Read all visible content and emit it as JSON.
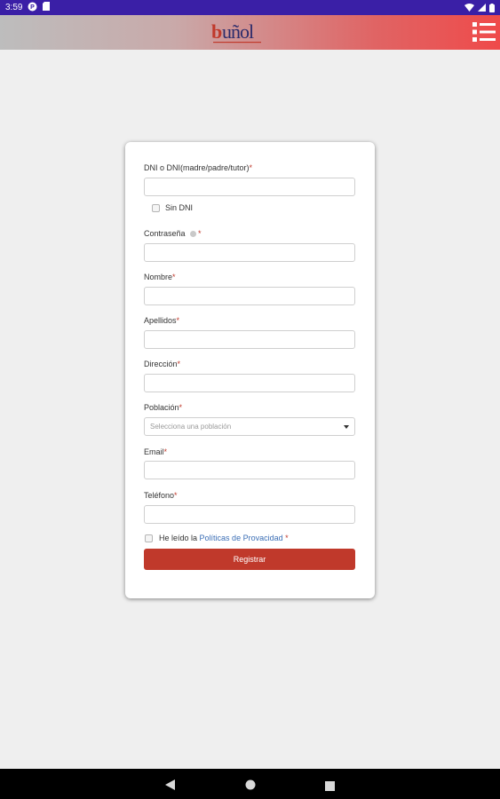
{
  "status_bar": {
    "time": "3:59",
    "icons": [
      "notification-app-icon",
      "sd-card-icon",
      "wifi-icon",
      "signal-icon",
      "battery-icon"
    ]
  },
  "header": {
    "logo_text": "buñol",
    "menu_icon": "menu-list-icon",
    "colors": {
      "start": "#bdbdbd",
      "end": "#ef4a4a"
    }
  },
  "form": {
    "dni": {
      "label": "DNI o DNI(madre/padre/tutor)",
      "required_mark": "*",
      "value": "",
      "placeholder": ""
    },
    "no_dni": {
      "label": "Sin DNI",
      "checked": false
    },
    "password": {
      "label": "Contraseña",
      "required_mark": "*",
      "value": "",
      "help_icon": "info-icon"
    },
    "name": {
      "label": "Nombre",
      "required_mark": "*",
      "value": ""
    },
    "surname": {
      "label": "Apellidos",
      "required_mark": "*",
      "value": ""
    },
    "address": {
      "label": "Dirección",
      "required_mark": "*",
      "value": ""
    },
    "town": {
      "label": "Población",
      "required_mark": "*",
      "selected": "Selecciona una población"
    },
    "email": {
      "label": "Email",
      "required_mark": "*",
      "value": ""
    },
    "phone": {
      "label": "Teléfono",
      "required_mark": "*",
      "value": ""
    },
    "privacy": {
      "prefix": "He leído la",
      "link": "Políticas de Provacidad",
      "required_mark": "*",
      "checked": false
    },
    "submit_label": "Registrar",
    "accent_color": "#c0392b"
  },
  "nav_bar": {
    "buttons": [
      "back-icon",
      "home-icon",
      "recents-icon"
    ]
  }
}
